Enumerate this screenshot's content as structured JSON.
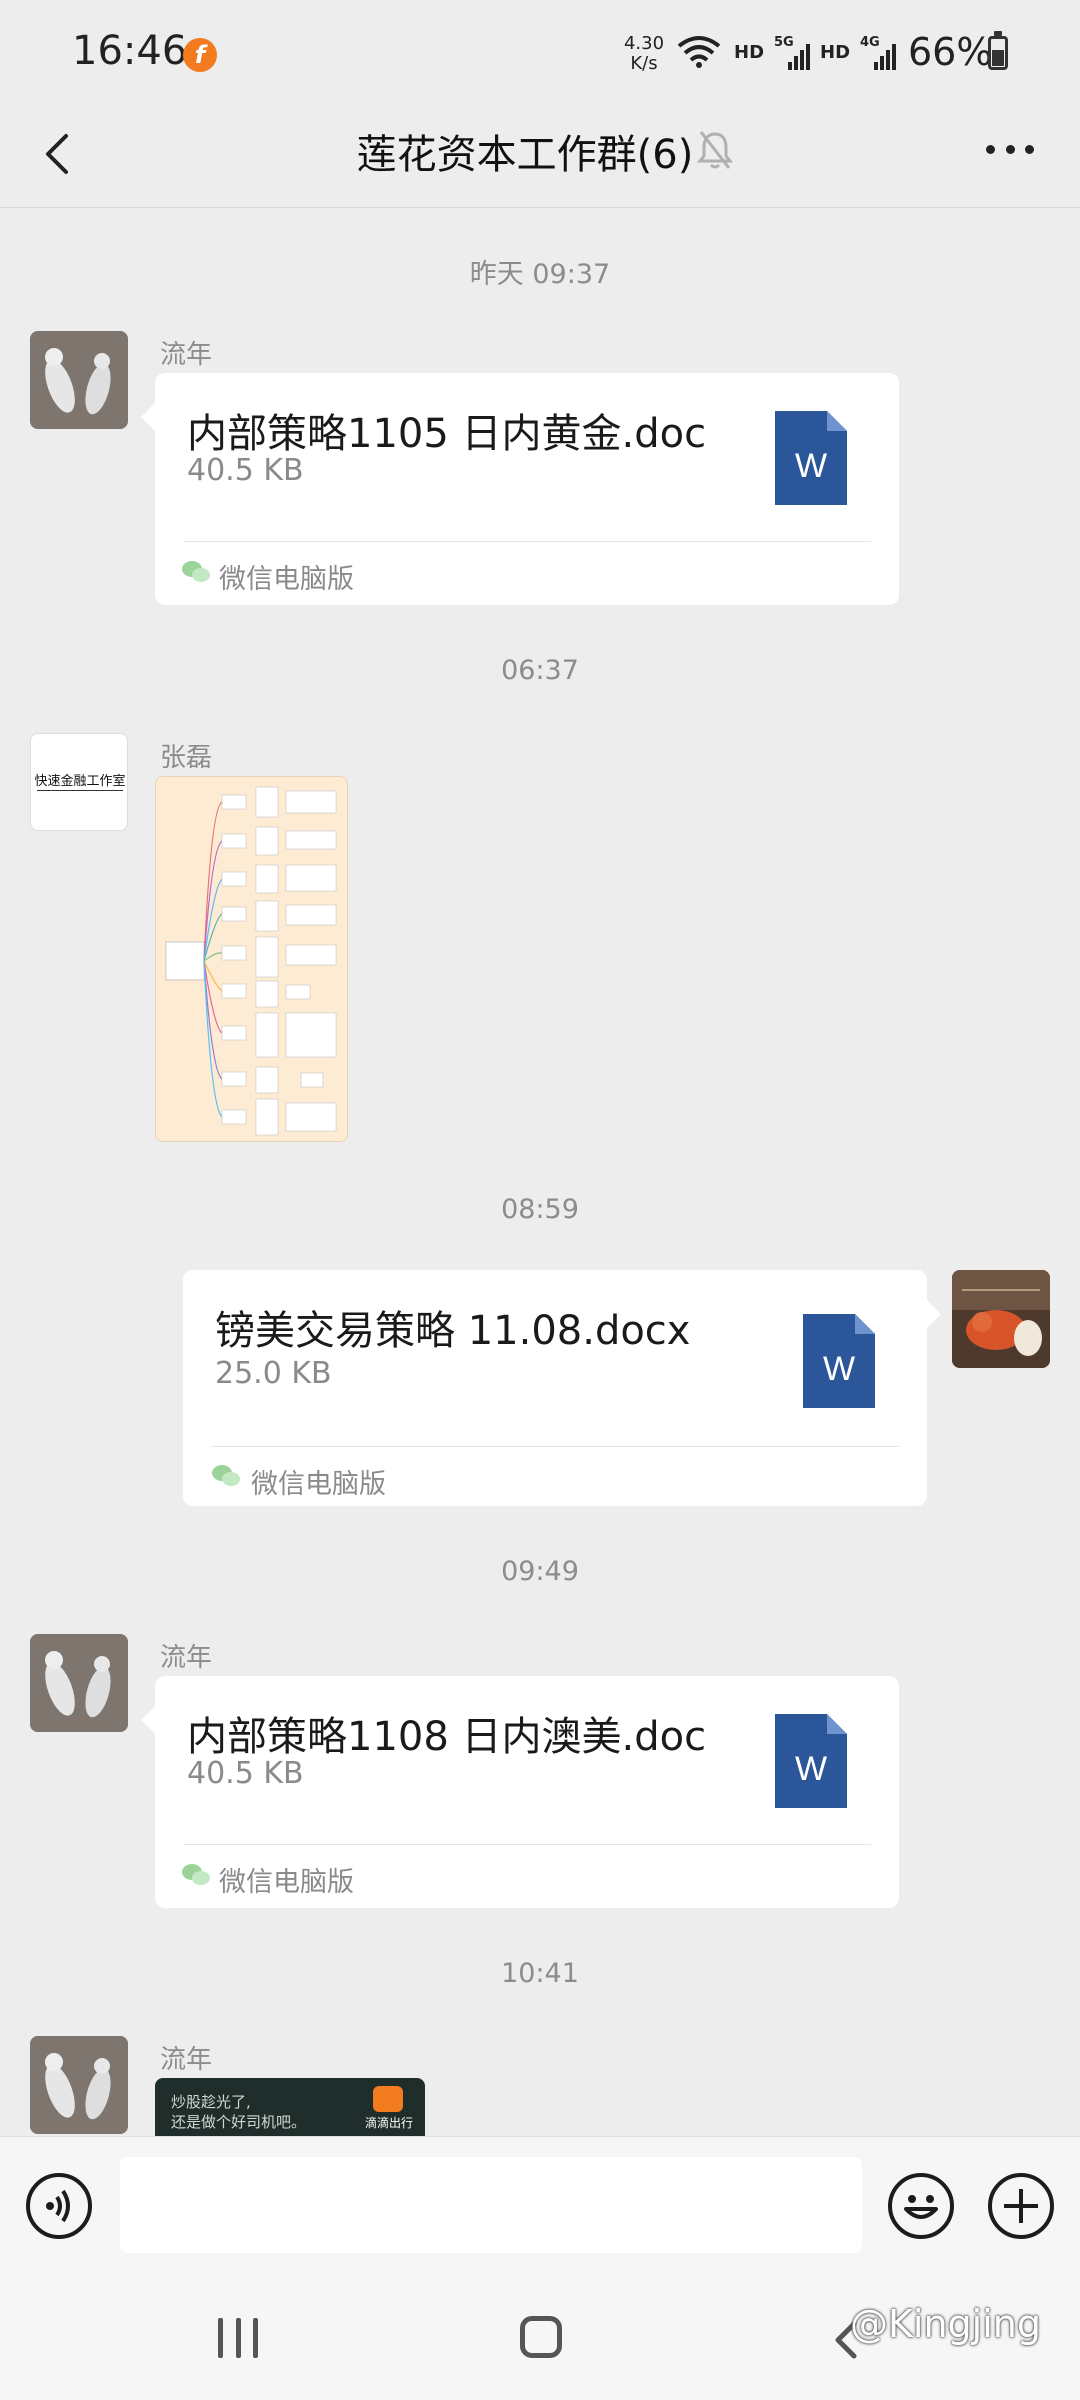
{
  "status_bar": {
    "time": "16:46",
    "net_speed_value": "4.30",
    "net_speed_unit": "K/s",
    "hd_1": "HD",
    "network_1": "5G",
    "hd_2": "HD",
    "network_2": "4G",
    "battery": "66%"
  },
  "header": {
    "title": "莲花资本工作群(6)"
  },
  "messages": {
    "ts1": "昨天 09:37",
    "m1": {
      "sender": "流年",
      "file_name": "内部策略1105 日内黄金.doc",
      "file_size": "40.5 KB",
      "source": "微信电脑版"
    },
    "ts2": "06:37",
    "m2": {
      "sender": "张磊",
      "avatar_text": "快速金融工作室"
    },
    "ts3": "08:59",
    "m3": {
      "file_name": "镑美交易策略 11.08.docx",
      "file_size": "25.0 KB",
      "source": "微信电脑版"
    },
    "ts4": "09:49",
    "m4": {
      "sender": "流年",
      "file_name": "内部策略1108 日内澳美.doc",
      "file_size": "40.5 KB",
      "source": "微信电脑版"
    },
    "ts5": "10:41",
    "m5": {
      "sender": "流年",
      "preview_line1": "炒股趁光了,",
      "preview_line2": "还是做个好司机吧。",
      "preview_brand": "滴滴出行"
    }
  },
  "input": {
    "placeholder": ""
  },
  "watermark": "@Kingjing",
  "colors": {
    "background": "#ededed",
    "bubble": "#ffffff",
    "word_blue": "#2b579a",
    "wechat_green": "#07c160"
  }
}
